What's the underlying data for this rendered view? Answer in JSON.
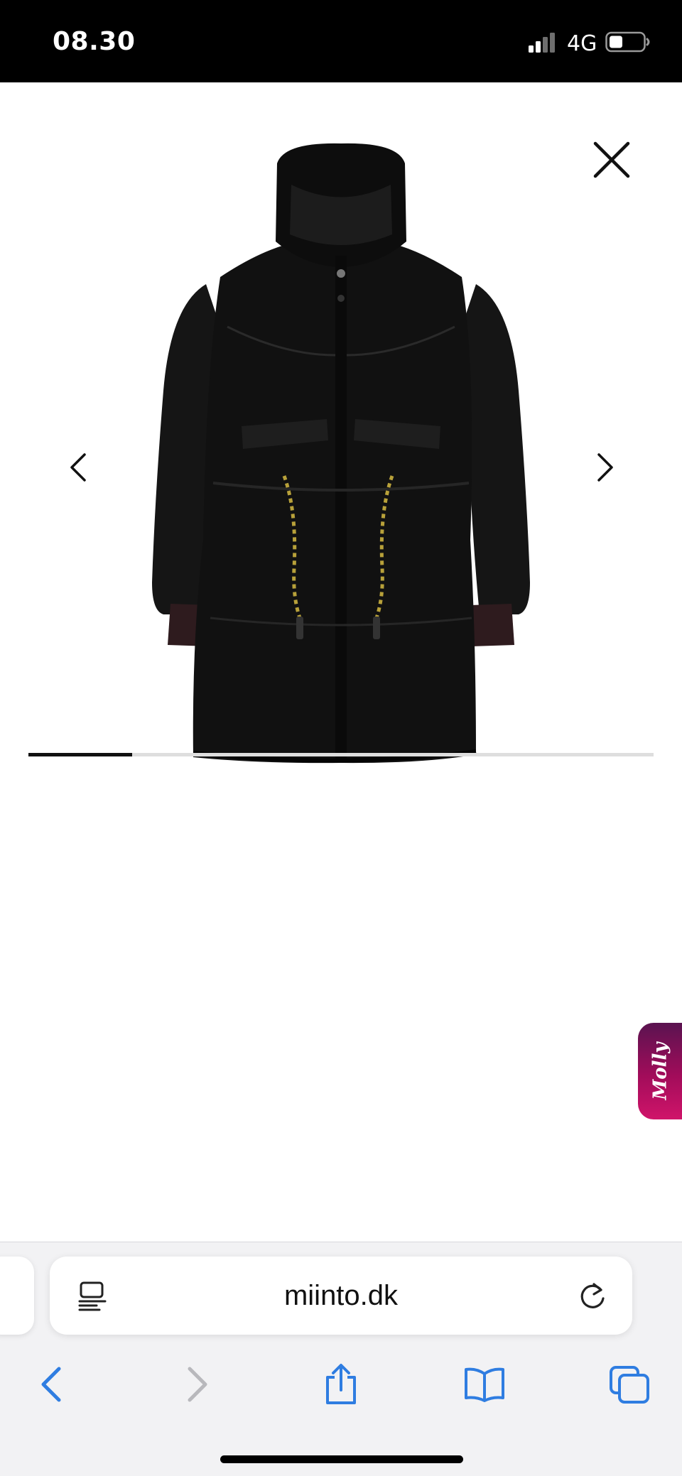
{
  "status_bar": {
    "time": "08.30",
    "network": "4G",
    "signal_icon": "cellular-signal-icon",
    "battery_icon": "battery-icon"
  },
  "viewer": {
    "close_icon": "close-icon",
    "prev_icon": "chevron-left-icon",
    "next_icon": "chevron-right-icon",
    "product_image": "black-hooded-parka-coat",
    "progress_fraction": 0.166,
    "accent_color": "#111111"
  },
  "chat_widget": {
    "label": "Molly",
    "gradient_start": "#5a1350",
    "gradient_end": "#d0146a"
  },
  "browser": {
    "url": "miinto.dk",
    "reader_icon": "reader-mode-icon",
    "reload_icon": "reload-icon",
    "toolbar": {
      "back_icon": "back-arrow-icon",
      "forward_icon": "forward-arrow-icon",
      "share_icon": "share-icon",
      "bookmarks_icon": "bookmarks-icon",
      "tabs_icon": "tabs-icon"
    },
    "tint_color": "#2f7de1"
  }
}
